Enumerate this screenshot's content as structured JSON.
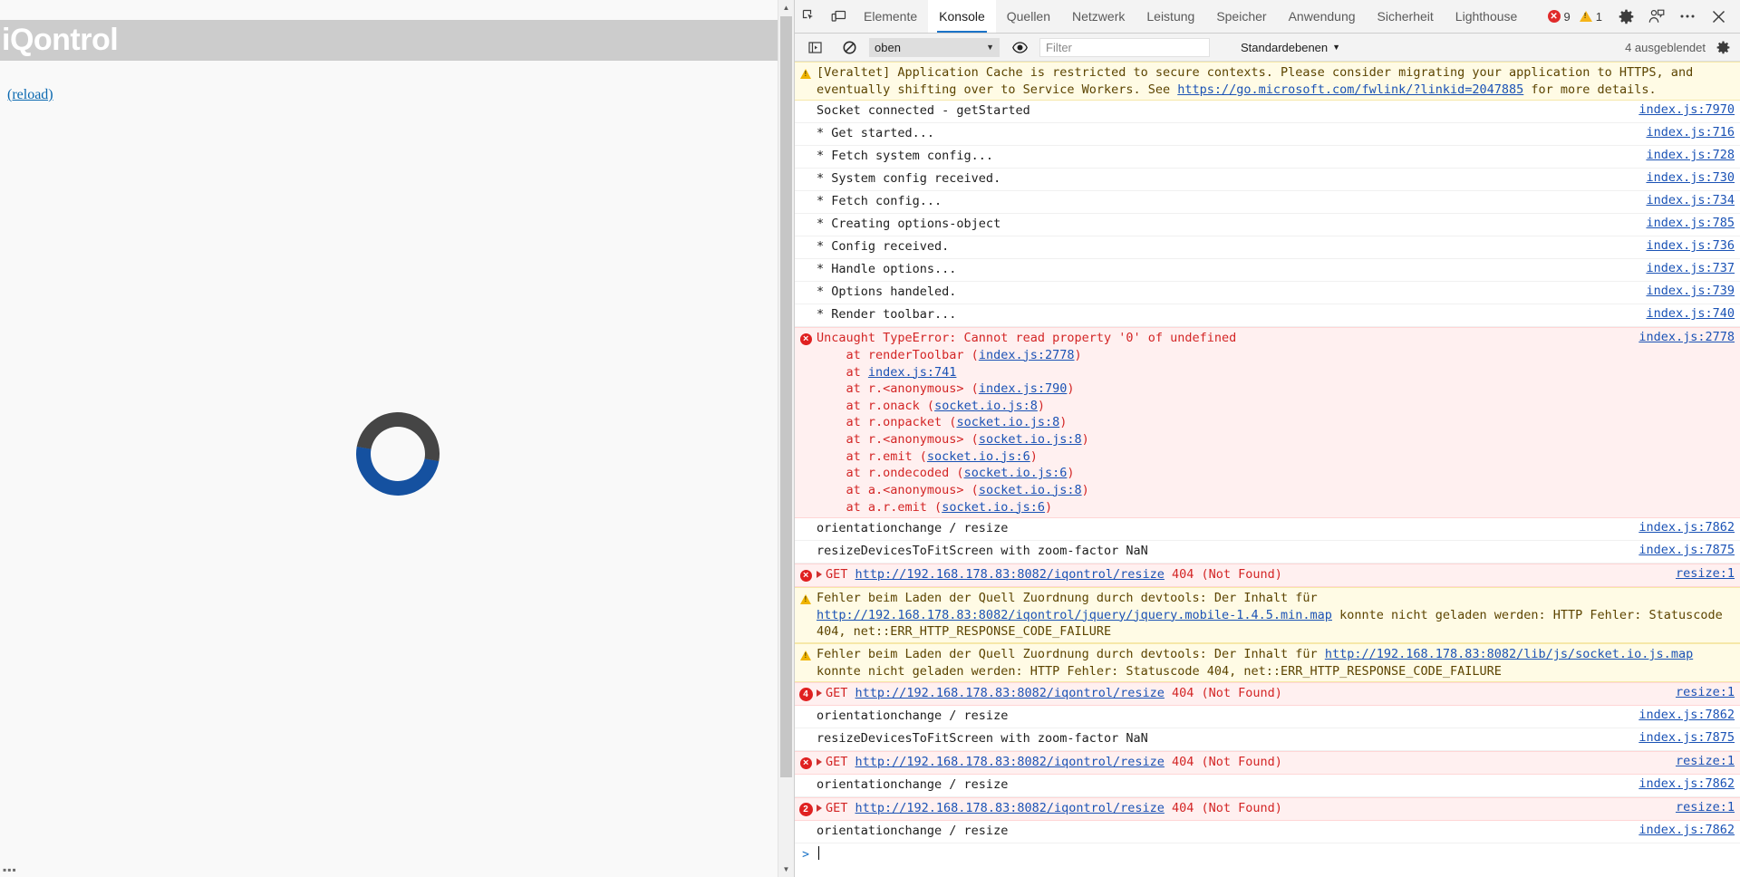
{
  "page": {
    "title": "iQontrol",
    "reload_link": "(reload)",
    "spinner": "loading-spinner",
    "header_bg": "#cccccc",
    "spinner_colors": {
      "track": "#454545",
      "accent": "#1551a0"
    }
  },
  "devtools": {
    "tabs": [
      {
        "label": "Elemente",
        "active": false
      },
      {
        "label": "Konsole",
        "active": true
      },
      {
        "label": "Quellen",
        "active": false
      },
      {
        "label": "Netzwerk",
        "active": false
      },
      {
        "label": "Leistung",
        "active": false
      },
      {
        "label": "Speicher",
        "active": false
      },
      {
        "label": "Anwendung",
        "active": false
      },
      {
        "label": "Sicherheit",
        "active": false
      },
      {
        "label": "Lighthouse",
        "active": false
      }
    ],
    "icons": {
      "inspect": "inspect-element-icon",
      "device": "device-toolbar-icon",
      "settings": "gear-icon",
      "feedback": "feedback-icon",
      "more": "more-options-icon",
      "close": "close-icon"
    },
    "counters": {
      "errors": "9",
      "warnings": "1"
    },
    "console_toolbar": {
      "sidebar_toggle": "console-sidebar-icon",
      "clear": "clear-console-icon",
      "context_value": "oben",
      "eye_icon": "live-expression-icon",
      "filter_placeholder": "Filter",
      "filter_value": "",
      "levels_label": "Standardebenen",
      "hidden_label": "4 ausgeblendet",
      "settings_icon": "console-settings-icon"
    }
  },
  "console_messages": [
    {
      "type": "warn",
      "icon": "warning-icon",
      "parts": [
        {
          "t": "[Veraltet] Application Cache is restricted to secure contexts. Please consider migrating your application to HTTPS, and eventually shifting over to Service Workers. See "
        },
        {
          "t": "https://go.microsoft.com/fwlink/?linkid=2047885",
          "link": true
        },
        {
          "t": " for more details."
        }
      ],
      "source": ""
    },
    {
      "type": "log",
      "parts": [
        {
          "t": "Socket connected - getStarted"
        }
      ],
      "source": "index.js:7970"
    },
    {
      "type": "log",
      "parts": [
        {
          "t": "* Get started..."
        }
      ],
      "source": "index.js:716"
    },
    {
      "type": "log",
      "parts": [
        {
          "t": "* Fetch system config..."
        }
      ],
      "source": "index.js:728"
    },
    {
      "type": "log",
      "parts": [
        {
          "t": "* System config received."
        }
      ],
      "source": "index.js:730"
    },
    {
      "type": "log",
      "parts": [
        {
          "t": "* Fetch config..."
        }
      ],
      "source": "index.js:734"
    },
    {
      "type": "log",
      "parts": [
        {
          "t": "* Creating options-object"
        }
      ],
      "source": "index.js:785"
    },
    {
      "type": "log",
      "parts": [
        {
          "t": "* Config received."
        }
      ],
      "source": "index.js:736"
    },
    {
      "type": "log",
      "parts": [
        {
          "t": "* Handle options..."
        }
      ],
      "source": "index.js:737"
    },
    {
      "type": "log",
      "parts": [
        {
          "t": "* Options handeled."
        }
      ],
      "source": "index.js:739"
    },
    {
      "type": "log",
      "parts": [
        {
          "t": "* Render toolbar..."
        }
      ],
      "source": "index.js:740"
    },
    {
      "type": "error",
      "icon": "error-icon",
      "parts": [
        {
          "t": "Uncaught TypeError: Cannot read property '0' of undefined"
        }
      ],
      "source": "index.js:2778",
      "stack": [
        [
          {
            "t": "    at renderToolbar ("
          },
          {
            "t": "index.js:2778",
            "link": true
          },
          {
            "t": ")"
          }
        ],
        [
          {
            "t": "    at "
          },
          {
            "t": "index.js:741",
            "link": true
          }
        ],
        [
          {
            "t": "    at r.<anonymous> ("
          },
          {
            "t": "index.js:790",
            "link": true
          },
          {
            "t": ")"
          }
        ],
        [
          {
            "t": "    at r.onack ("
          },
          {
            "t": "socket.io.js:8",
            "link": true
          },
          {
            "t": ")"
          }
        ],
        [
          {
            "t": "    at r.onpacket ("
          },
          {
            "t": "socket.io.js:8",
            "link": true
          },
          {
            "t": ")"
          }
        ],
        [
          {
            "t": "    at r.<anonymous> ("
          },
          {
            "t": "socket.io.js:8",
            "link": true
          },
          {
            "t": ")"
          }
        ],
        [
          {
            "t": "    at r.emit ("
          },
          {
            "t": "socket.io.js:6",
            "link": true
          },
          {
            "t": ")"
          }
        ],
        [
          {
            "t": "    at r.ondecoded ("
          },
          {
            "t": "socket.io.js:6",
            "link": true
          },
          {
            "t": ")"
          }
        ],
        [
          {
            "t": "    at a.<anonymous> ("
          },
          {
            "t": "socket.io.js:8",
            "link": true
          },
          {
            "t": ")"
          }
        ],
        [
          {
            "t": "    at a.r.emit ("
          },
          {
            "t": "socket.io.js:6",
            "link": true
          },
          {
            "t": ")"
          }
        ]
      ]
    },
    {
      "type": "log",
      "parts": [
        {
          "t": "orientationchange / resize"
        }
      ],
      "source": "index.js:7862"
    },
    {
      "type": "log",
      "parts": [
        {
          "t": "resizeDevicesToFitScreen with zoom-factor NaN"
        }
      ],
      "source": "index.js:7875"
    },
    {
      "type": "error",
      "icon": "error-icon",
      "expandable": true,
      "parts": [
        {
          "t": "GET "
        },
        {
          "t": "http://192.168.178.83:8082/iqontrol/resize",
          "link": true
        },
        {
          "t": " 404 (Not Found)"
        }
      ],
      "source": "resize:1"
    },
    {
      "type": "warn",
      "icon": "warning-icon",
      "parts": [
        {
          "t": "Fehler beim Laden der Quell Zuordnung durch devtools: Der Inhalt für "
        },
        {
          "t": "http://192.168.178.83:8082/iqontrol/jquery/jquery.mobile-1.4.5.min.map",
          "link": true
        },
        {
          "t": " konnte nicht geladen werden: HTTP Fehler: Statuscode 404, net::ERR_HTTP_RESPONSE_CODE_FAILURE"
        }
      ],
      "source": ""
    },
    {
      "type": "warn",
      "icon": "warning-icon",
      "parts": [
        {
          "t": "Fehler beim Laden der Quell Zuordnung durch devtools: Der Inhalt für "
        },
        {
          "t": "http://192.168.178.83:8082/lib/js/socket.io.js.map",
          "link": true
        },
        {
          "t": " konnte nicht geladen werden: HTTP Fehler: Statuscode 404, net::ERR_HTTP_RESPONSE_CODE_FAILURE"
        }
      ],
      "source": ""
    },
    {
      "type": "error",
      "icon": "error-count-icon",
      "count": "4",
      "expandable": true,
      "parts": [
        {
          "t": "GET "
        },
        {
          "t": "http://192.168.178.83:8082/iqontrol/resize",
          "link": true
        },
        {
          "t": " 404 (Not Found)"
        }
      ],
      "source": "resize:1"
    },
    {
      "type": "log",
      "parts": [
        {
          "t": "orientationchange / resize"
        }
      ],
      "source": "index.js:7862"
    },
    {
      "type": "log",
      "parts": [
        {
          "t": "resizeDevicesToFitScreen with zoom-factor NaN"
        }
      ],
      "source": "index.js:7875"
    },
    {
      "type": "error",
      "icon": "error-icon",
      "expandable": true,
      "parts": [
        {
          "t": "GET "
        },
        {
          "t": "http://192.168.178.83:8082/iqontrol/resize",
          "link": true
        },
        {
          "t": " 404 (Not Found)"
        }
      ],
      "source": "resize:1"
    },
    {
      "type": "log",
      "parts": [
        {
          "t": "orientationchange / resize"
        }
      ],
      "source": "index.js:7862"
    },
    {
      "type": "error",
      "icon": "error-count-icon",
      "count": "2",
      "expandable": true,
      "parts": [
        {
          "t": "GET "
        },
        {
          "t": "http://192.168.178.83:8082/iqontrol/resize",
          "link": true
        },
        {
          "t": " 404 (Not Found)"
        }
      ],
      "source": "resize:1"
    },
    {
      "type": "log",
      "parts": [
        {
          "t": "orientationchange / resize"
        }
      ],
      "source": "index.js:7862"
    }
  ],
  "prompt": {
    "caret": ">"
  }
}
